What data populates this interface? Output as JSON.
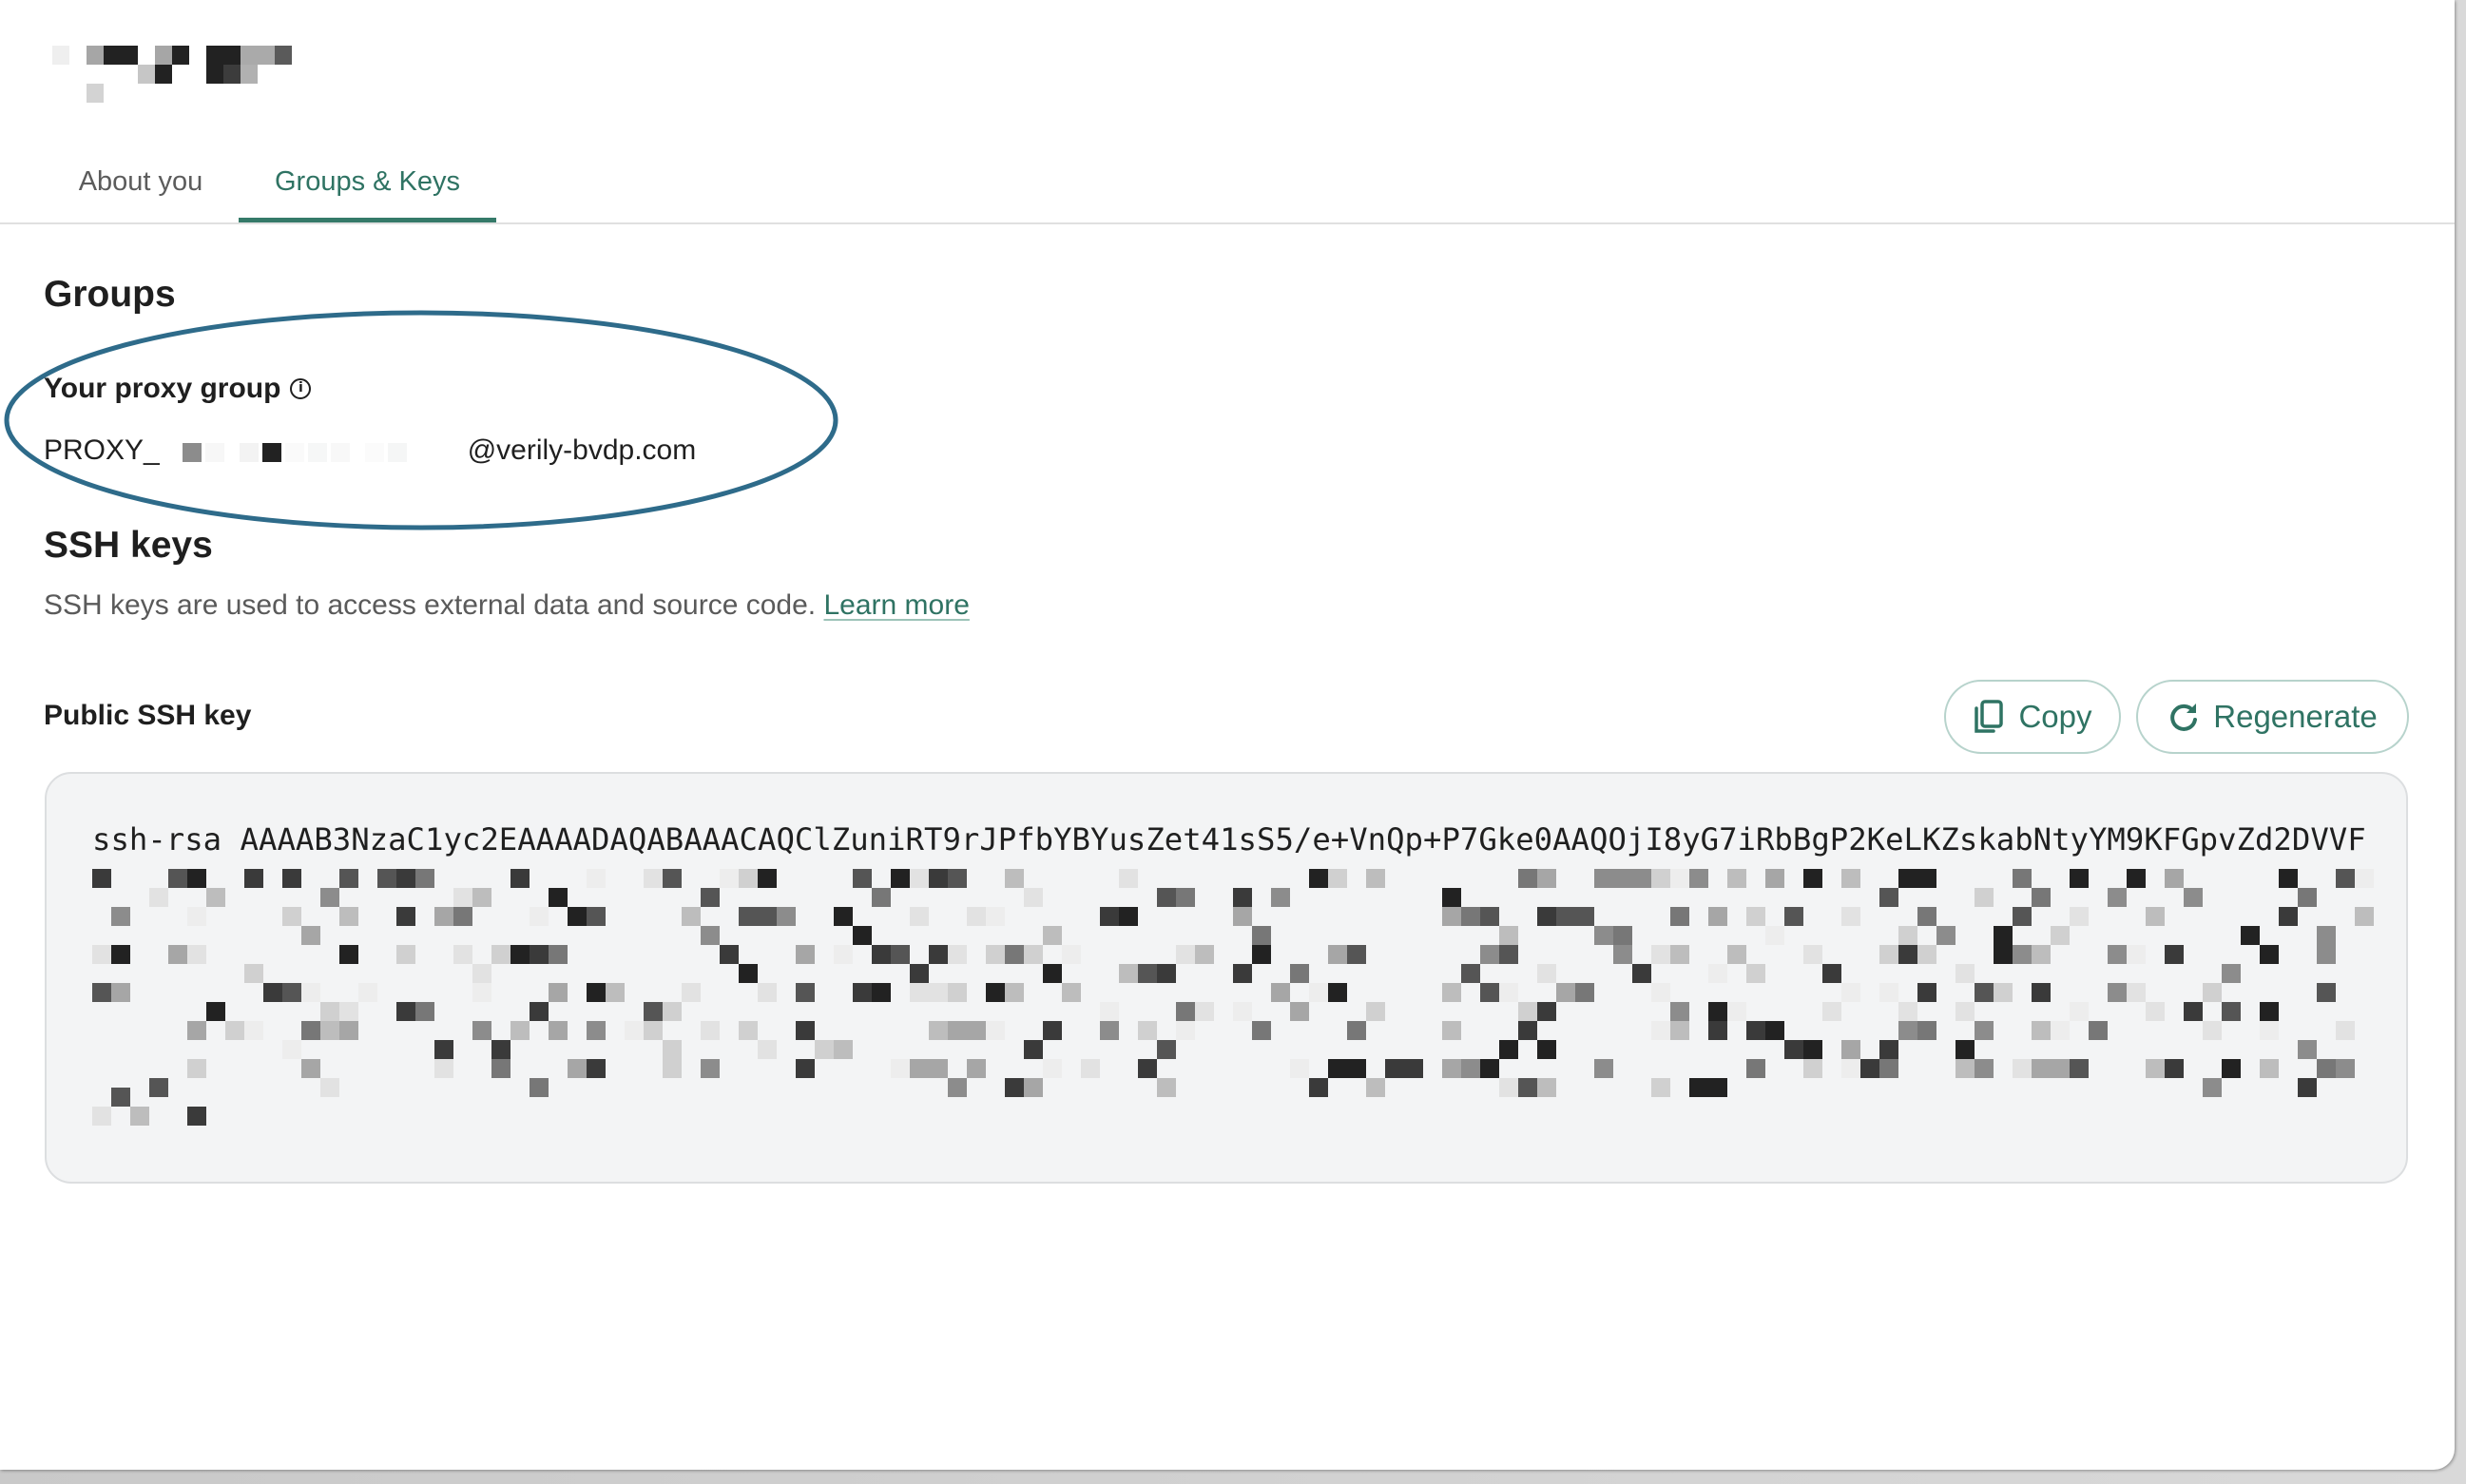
{
  "header": {
    "title_redacted": true
  },
  "tabs": [
    {
      "label": "About you",
      "active": false
    },
    {
      "label": "Groups & Keys",
      "active": true
    }
  ],
  "groups": {
    "heading": "Groups",
    "proxy_group_label": "Your proxy group",
    "proxy_group_info_icon": "info-icon",
    "proxy_email_prefix": "PROXY_",
    "proxy_email_suffix": "@verily-bvdp.com",
    "proxy_email_redacted": true
  },
  "ssh": {
    "heading": "SSH keys",
    "description": "SSH keys are used to access external data and source code.",
    "learn_more": "Learn more",
    "public_key_label": "Public SSH key",
    "copy_button": "Copy",
    "copy_icon": "copy-icon",
    "regenerate_button": "Regenerate",
    "regenerate_icon": "refresh-icon",
    "key_first_line": "ssh-rsa AAAAB3NzaC1yc2EAAAADAQABAAACAQClZuniRT9rJPfbYBYusZet41sS5/e+VnQp+P7Gke0AAQOjI8yG7iRbBgP2KeLKZskabNtyYM9KFGpvZd2DVVF",
    "key_rest_redacted": true
  },
  "colors": {
    "accent": "#2f7363",
    "annotation_ellipse": "#2e6b8a",
    "key_box_bg": "#f3f4f5"
  }
}
